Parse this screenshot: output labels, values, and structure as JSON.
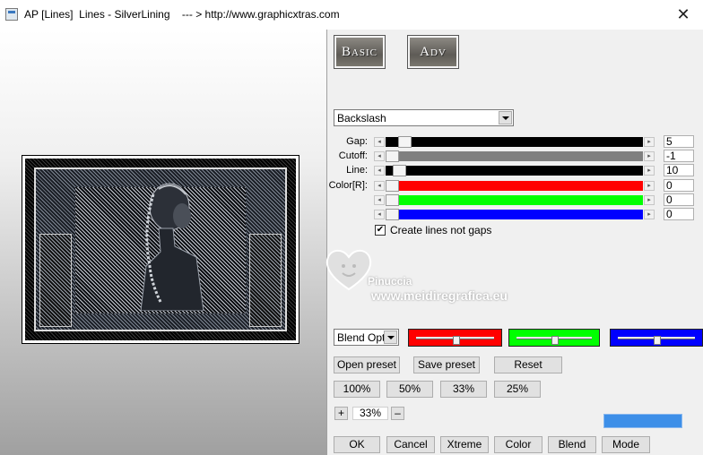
{
  "window": {
    "title": "AP [Lines]  Lines - SilverLining    --- > http://www.graphicxtras.com",
    "close_glyph": "✕"
  },
  "tabs": {
    "basic_label": "Basic",
    "adv_label": "Adv"
  },
  "pattern_select": {
    "value": "Backslash"
  },
  "sliders": [
    {
      "label": "Gap:",
      "value": "5",
      "track_color": "#000000",
      "level": 0.05
    },
    {
      "label": "Cutoff:",
      "value": "-1",
      "track_color": "#808080",
      "level": 0.0
    },
    {
      "label": "Line:",
      "value": "10",
      "track_color": "#000000",
      "level": 0.03
    },
    {
      "label": "Color[R]:",
      "value": "0",
      "track_color": "#ff0000",
      "level": 0.0
    },
    {
      "label": "",
      "value": "0",
      "track_color": "#00ff00",
      "level": 0.0
    },
    {
      "label": "",
      "value": "0",
      "track_color": "#0000ff",
      "level": 0.0
    }
  ],
  "checkbox": {
    "label": "Create lines not gaps",
    "checked": true,
    "mark": "✔"
  },
  "watermark": {
    "name": "Pinuccia",
    "url": "www.meidiregrafica.eu"
  },
  "blend_select": {
    "value": "Blend Opti"
  },
  "color_sliders": [
    {
      "color": "#ff0000",
      "level": 0.5
    },
    {
      "color": "#00ff00",
      "level": 0.5
    },
    {
      "color": "#0000ff",
      "level": 0.5
    }
  ],
  "preset_buttons": {
    "open": "Open preset",
    "save": "Save preset",
    "reset": "Reset"
  },
  "zoom_buttons": [
    "100%",
    "50%",
    "33%",
    "25%"
  ],
  "zoom": {
    "plus": "+",
    "value": "33%",
    "minus": "–"
  },
  "bottom_buttons": [
    "OK",
    "Cancel",
    "Xtreme",
    "Color",
    "Blend",
    "Mode"
  ],
  "accent_color": "#3d8fe8"
}
